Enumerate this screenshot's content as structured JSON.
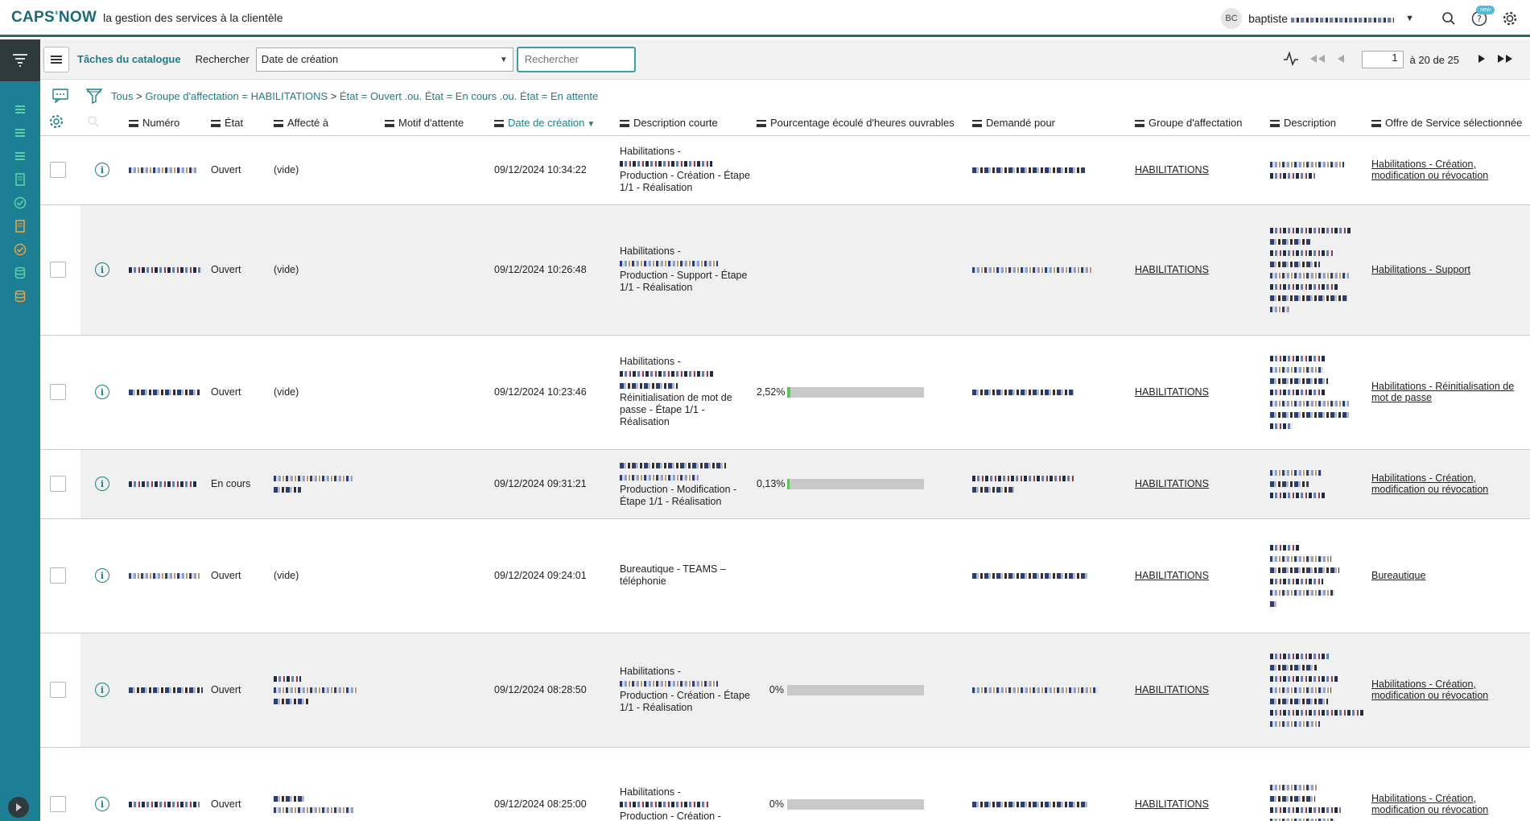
{
  "header": {
    "logo_main": "CAPS",
    "logo_apos": "'",
    "logo_end": "NOW",
    "tagline": "la gestion des services à la clientèle",
    "avatar_initials": "BC",
    "username": "baptiste",
    "badge": "new"
  },
  "toolbar": {
    "list_title": "Tâches du catalogue",
    "search_label": "Rechercher",
    "search_field": "Date de création",
    "search_placeholder": "Rechercher",
    "page_value": "1",
    "page_range": "à 20 de 25"
  },
  "breadcrumb": {
    "all": "Tous",
    "group": "Groupe d'affectation = HABILITATIONS",
    "state": "État = Ouvert .ou. État = En cours .ou. État = En attente"
  },
  "columns": {
    "numero": "Numéro",
    "etat": "État",
    "affecte": "Affecté à",
    "motif": "Motif d'attente",
    "date": "Date de création",
    "desc_courte": "Description courte",
    "pourcentage": "Pourcentage écoulé d'heures ouvrables",
    "demande": "Demandé pour",
    "groupe": "Groupe d'affectation",
    "description": "Description",
    "offre": "Offre de Service sélectionnée"
  },
  "rows": [
    {
      "etat": "Ouvert",
      "affecte": "(vide)",
      "date": "09/12/2024 10:34:22",
      "desc1": "Habilitations -",
      "desc2": "Production - Création - Étape 1/1 - Réalisation",
      "pct": "",
      "pct_value": null,
      "groupe": "HABILITATIONS",
      "offre": "Habilitations - Création, modification ou révocation"
    },
    {
      "etat": "Ouvert",
      "affecte": "(vide)",
      "date": "09/12/2024 10:26:48",
      "desc1": "Habilitations -",
      "desc2": "Production - Support - Étape 1/1 - Réalisation",
      "pct": "",
      "pct_value": null,
      "groupe": "HABILITATIONS",
      "offre": "Habilitations - Support"
    },
    {
      "etat": "Ouvert",
      "affecte": "(vide)",
      "date": "09/12/2024 10:23:46",
      "desc1": "Habilitations -",
      "desc2": "Réinitialisation de mot de passe - Étape 1/1 - Réalisation",
      "pct": "2,52%",
      "pct_value": 2.52,
      "groupe": "HABILITATIONS",
      "offre": "Habilitations - Réinitialisation de mot de passe"
    },
    {
      "etat": "En cours",
      "affecte": "",
      "date": "09/12/2024 09:31:21",
      "desc1": "",
      "desc2": "Production - Modification - Étape 1/1 - Réalisation",
      "pct": "0,13%",
      "pct_value": 0.13,
      "groupe": "HABILITATIONS",
      "offre": "Habilitations - Création, modification ou révocation"
    },
    {
      "etat": "Ouvert",
      "affecte": "(vide)",
      "date": "09/12/2024 09:24:01",
      "desc1": "",
      "desc2": "Bureautique - TEAMS – téléphonie",
      "pct": "",
      "pct_value": null,
      "groupe": "HABILITATIONS",
      "offre": "Bureautique"
    },
    {
      "etat": "Ouvert",
      "affecte": "",
      "date": "09/12/2024 08:28:50",
      "desc1": "Habilitations -",
      "desc2": "Production - Création - Étape 1/1 - Réalisation",
      "pct": "0%",
      "pct_value": 0,
      "groupe": "HABILITATIONS",
      "offre": "Habilitations - Création, modification ou révocation"
    },
    {
      "etat": "Ouvert",
      "affecte": "",
      "date": "09/12/2024 08:25:00",
      "desc1": "Habilitations -",
      "desc2": "Production - Création -",
      "pct": "0%",
      "pct_value": 0,
      "groupe": "HABILITATIONS",
      "offre": "Habilitations - Création, modification ou révocation"
    }
  ],
  "colors": {
    "accent": "#1d7d8a",
    "nav": "#1c7f94",
    "progress": "#5cc45c"
  }
}
